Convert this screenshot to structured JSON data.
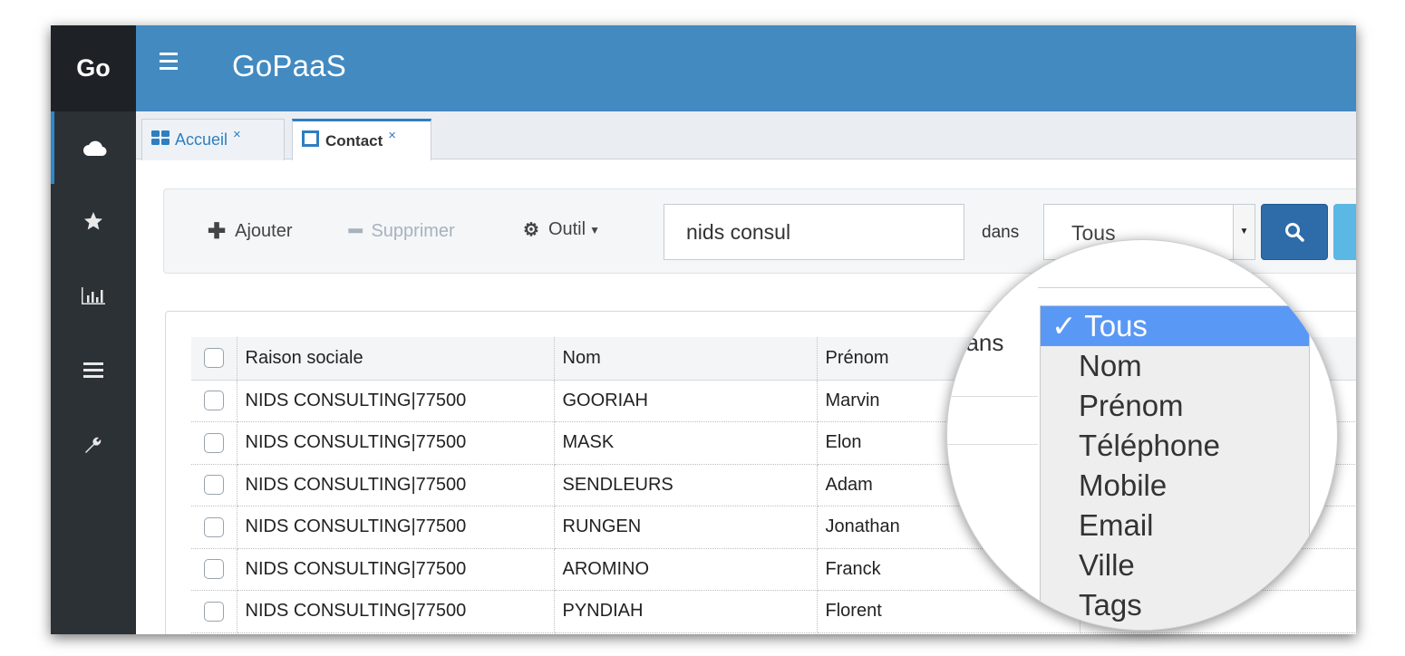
{
  "sidebar": {
    "brand": "Go",
    "items": [
      {
        "icon": "cloud-icon"
      },
      {
        "icon": "star-icon"
      },
      {
        "icon": "bar-chart-icon"
      },
      {
        "icon": "list-icon"
      },
      {
        "icon": "wrench-icon"
      }
    ]
  },
  "header": {
    "title": "GoPaaS"
  },
  "tabs": [
    {
      "label": "Accueil",
      "close": "×"
    },
    {
      "label": "Contact",
      "close": "×"
    }
  ],
  "toolbar": {
    "add_label": "Ajouter",
    "delete_label": "Supprimer",
    "tools_label": "Outil",
    "search_value": "nids consul",
    "in_label": "dans",
    "field_selected": "Tous"
  },
  "table": {
    "columns": [
      "Raison sociale",
      "Nom",
      "Prénom"
    ],
    "rows": [
      {
        "raison": "NIDS CONSULTING|77500",
        "nom": "GOORIAH",
        "prenom": "Marvin"
      },
      {
        "raison": "NIDS CONSULTING|77500",
        "nom": "MASK",
        "prenom": "Elon"
      },
      {
        "raison": "NIDS CONSULTING|77500",
        "nom": "SENDLEURS",
        "prenom": "Adam"
      },
      {
        "raison": "NIDS CONSULTING|77500",
        "nom": "RUNGEN",
        "prenom": "Jonathan"
      },
      {
        "raison": "NIDS CONSULTING|77500",
        "nom": "AROMINO",
        "prenom": "Franck"
      },
      {
        "raison": "NIDS CONSULTING|77500",
        "nom": "PYNDIAH",
        "prenom": "Florent"
      }
    ]
  },
  "magnifier": {
    "in_label": "dans",
    "options": [
      "✓ Tous",
      "Nom",
      "Prénom",
      "Téléphone",
      "Mobile",
      "Email",
      "Ville",
      "Tags"
    ]
  },
  "colors": {
    "header": "#438ac1",
    "sidebar": "#2c3136",
    "accent": "#2f7ec0",
    "selected_option": "#5a98f5"
  }
}
